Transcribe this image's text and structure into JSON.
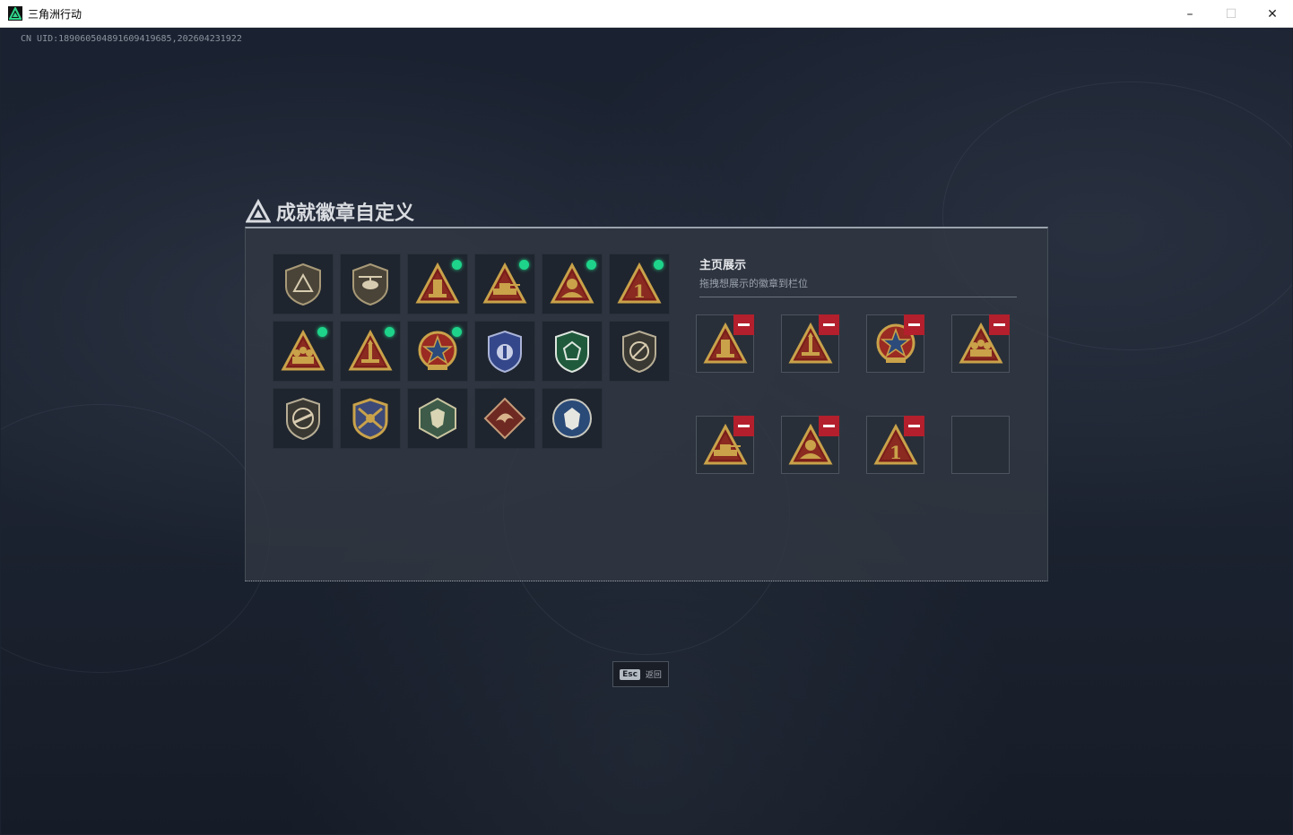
{
  "window": {
    "title": "三角洲行动",
    "controls": {
      "minimize": "–",
      "maximize": "☐",
      "close": "✕"
    }
  },
  "uid_text": "CN UID:189060504891609419685,202604231922",
  "dialog": {
    "title": "成就徽章自定义",
    "owned_badges": [
      {
        "icon": "shield-logo-badge",
        "new": false
      },
      {
        "icon": "helicopter-badge",
        "new": false
      },
      {
        "icon": "gold-triangle-tower-badge",
        "new": true
      },
      {
        "icon": "gold-triangle-tank-badge",
        "new": true
      },
      {
        "icon": "gold-triangle-soldier-badge",
        "new": true
      },
      {
        "icon": "gold-triangle-number-one-badge",
        "new": true
      },
      {
        "icon": "gold-triangle-squad-badge",
        "new": true
      },
      {
        "icon": "gold-triangle-rocket-badge",
        "new": true
      },
      {
        "icon": "star-medal-badge",
        "new": true
      },
      {
        "icon": "blue-police-badge",
        "new": false
      },
      {
        "icon": "green-shield-badge",
        "new": false
      },
      {
        "icon": "no-weapon-shield-badge",
        "new": false
      },
      {
        "icon": "rifle-shield-badge",
        "new": false
      },
      {
        "icon": "crossed-wings-badge",
        "new": false
      },
      {
        "icon": "hex-wolf-badge",
        "new": false
      },
      {
        "icon": "red-dragon-badge",
        "new": false
      },
      {
        "icon": "round-wolf-badge",
        "new": false
      }
    ],
    "display": {
      "heading": "主页展示",
      "subheading": "拖拽想展示的徽章到栏位",
      "slots": [
        {
          "icon": "gold-triangle-tower-badge",
          "filled": true
        },
        {
          "icon": "gold-triangle-rocket-badge",
          "filled": true
        },
        {
          "icon": "star-medal-badge",
          "filled": true
        },
        {
          "icon": "gold-triangle-squad-badge",
          "filled": true
        },
        {
          "icon": "gold-triangle-tank-badge",
          "filled": true
        },
        {
          "icon": "gold-triangle-soldier-badge",
          "filled": true
        },
        {
          "icon": "gold-triangle-number-one-badge",
          "filled": true
        },
        {
          "icon": "",
          "filled": false
        }
      ]
    }
  },
  "footer": {
    "esc_key": "Esc",
    "esc_label": "返回"
  },
  "colors": {
    "accent_green": "#1ed48a",
    "remove_red": "#b31f2c",
    "gold": "#c9a24a"
  }
}
